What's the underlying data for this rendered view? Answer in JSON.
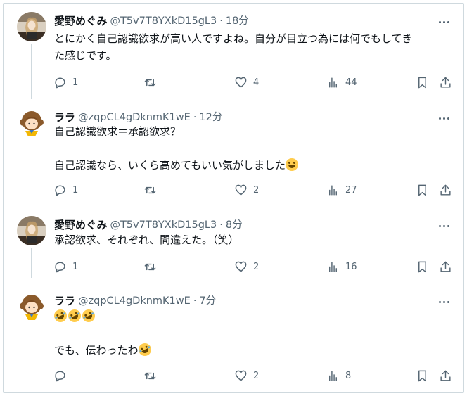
{
  "tweets": [
    {
      "name": "愛野めぐみ",
      "handle": "@T5v7T8YXkD15gL3",
      "time": "18分",
      "lines": [
        "とにかく自己認識欲求が高い人ですよね。自分が目立つ為には何でもしてき",
        "た感じです。"
      ],
      "replies": "1",
      "retweets": "",
      "likes": "4",
      "views": "44",
      "avatar": "woman-photo"
    },
    {
      "name": "ララ",
      "handle": "@zqpCL4gDknmK1wE",
      "time": "12分",
      "lines": [
        "自己認識欲求＝承認欲求？",
        "",
        "自己認識なら、いくら高めてもいい気がしました"
      ],
      "replies": "1",
      "retweets": "",
      "likes": "2",
      "views": "27",
      "avatar": "girl-illustration"
    },
    {
      "name": "愛野めぐみ",
      "handle": "@T5v7T8YXkD15gL3",
      "time": "8分",
      "lines": [
        "承認欲求、それぞれ、間違えた。（笑）"
      ],
      "replies": "1",
      "retweets": "",
      "likes": "2",
      "views": "16",
      "avatar": "woman-photo"
    },
    {
      "name": "ララ",
      "handle": "@zqpCL4gDknmK1wE",
      "time": "7分",
      "lines": [
        "",
        "",
        "でも、伝わったわ"
      ],
      "replies": "",
      "retweets": "",
      "likes": "2",
      "views": "8",
      "avatar": "girl-illustration"
    }
  ],
  "separator": "·",
  "icons": {
    "reply": "speech-bubble-icon",
    "retweet": "retweet-icon",
    "like": "heart-icon",
    "views": "bar-chart-icon",
    "bookmark": "bookmark-icon",
    "share": "share-upload-icon",
    "more": "more-dots-icon"
  },
  "colors": {
    "text": "#0f1419",
    "secondary": "#536471",
    "border": "#cfd9de"
  }
}
